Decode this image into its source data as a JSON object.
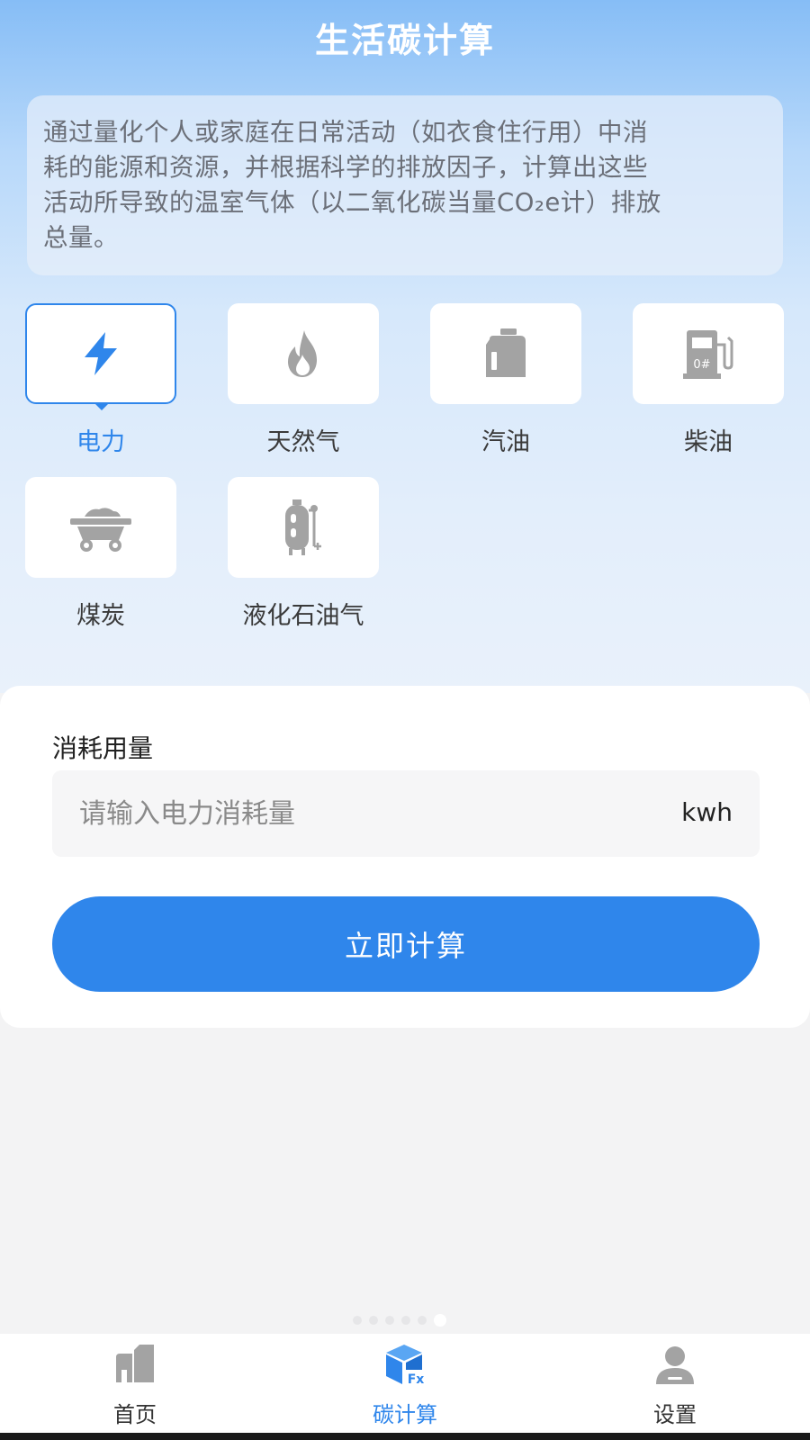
{
  "header": {
    "title": "生活碳计算"
  },
  "intro": {
    "lines": [
      "通过量化个人或家庭在日常活动（如衣食住行用）中消",
      "耗的能源和资源，并根据科学的排放因子，计算出这些",
      "活动所导致的温室气体（以二氧化碳当量CO₂e计）排放",
      "总量。"
    ]
  },
  "categories": [
    {
      "label": "电力",
      "icon": "lightning-icon",
      "selected": true
    },
    {
      "label": "天然气",
      "icon": "flame-icon",
      "selected": false
    },
    {
      "label": "汽油",
      "icon": "fuel-can-icon",
      "selected": false
    },
    {
      "label": "柴油",
      "icon": "fuel-pump-icon",
      "selected": false,
      "pump_mark": "0#"
    },
    {
      "label": "煤炭",
      "icon": "coal-cart-icon",
      "selected": false
    },
    {
      "label": "液化石油气",
      "icon": "gas-tank-icon",
      "selected": false
    }
  ],
  "form": {
    "label": "消耗用量",
    "input_value": "",
    "input_placeholder": "请输入电力消耗量",
    "unit": "kwh",
    "submit_label": "立即计算"
  },
  "tabbar": {
    "items": [
      {
        "label": "首页",
        "icon": "home-icon",
        "active": false
      },
      {
        "label": "碳计算",
        "icon": "cube-fx-icon",
        "active": true,
        "icon_text": "Fx"
      },
      {
        "label": "设置",
        "icon": "user-icon",
        "active": false
      }
    ]
  },
  "colors": {
    "accent": "#2f86eb",
    "icon_inactive": "#a3a3a3",
    "background": "#f3f3f4"
  }
}
